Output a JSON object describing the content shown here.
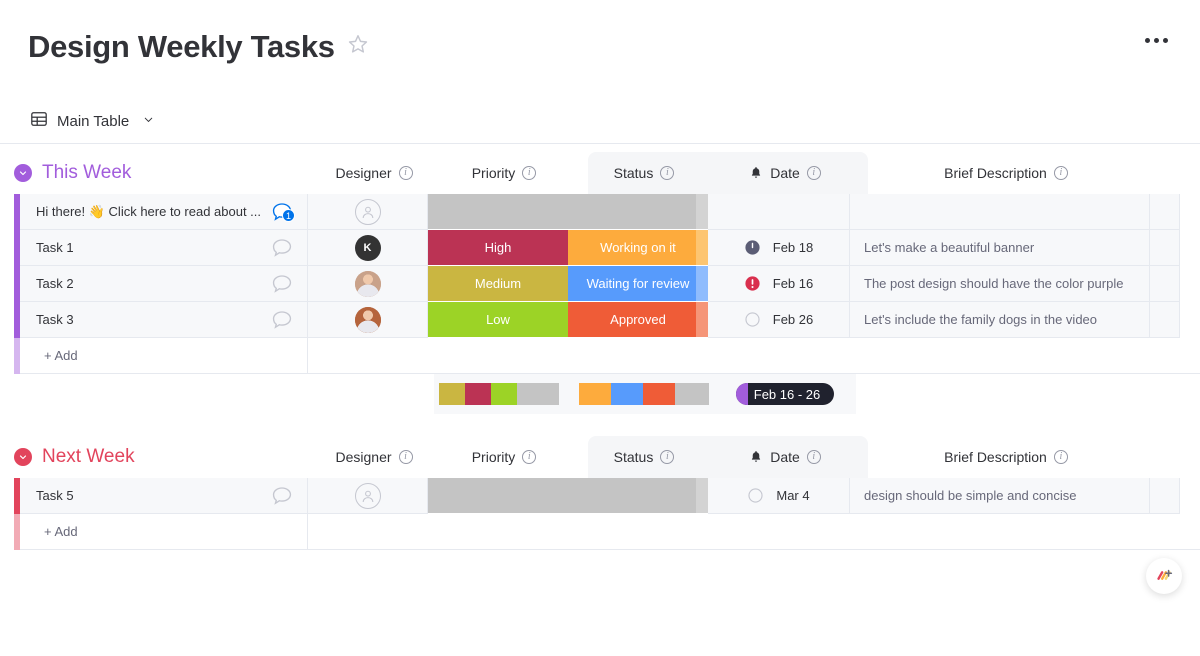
{
  "header": {
    "title": "Design Weekly Tasks",
    "favorite_icon": "star-icon",
    "menu_icon": "kebab-menu-icon"
  },
  "tab": {
    "icon": "table-icon",
    "label": "Main Table",
    "chevron_icon": "chevron-down-icon"
  },
  "columns": {
    "name": "",
    "person": "Designer",
    "priority": "Priority",
    "status": "Status",
    "date": "Date",
    "date_icon": "bell-icon",
    "description": "Brief Description",
    "info_icon": "info-icon"
  },
  "groups": [
    {
      "title": "This Week",
      "color": "#a25ddc",
      "add_label": "+ Add",
      "rows": [
        {
          "name": "Hi there! 👋 Click here to read about ...",
          "chat_badge": "1",
          "chat_style": "blue",
          "person": {
            "type": "empty",
            "label": ""
          },
          "priority": {
            "label": "",
            "color": "#c4c4c4"
          },
          "status": {
            "label": "",
            "color": "#c4c4c4",
            "tail": "#d3d3d3"
          },
          "date": {
            "label": "",
            "icon": "none"
          },
          "description": ""
        },
        {
          "name": "Task 1",
          "chat_badge": "",
          "chat_style": "grey",
          "person": {
            "type": "initial",
            "label": "K",
            "color": "#333333"
          },
          "priority": {
            "label": "High",
            "color": "#bb3354"
          },
          "status": {
            "label": "Working on it",
            "color": "#fdab3d",
            "tail": "#fdc571"
          },
          "date": {
            "label": "Feb 18",
            "icon": "clock"
          },
          "description": "Let's make a beautiful banner"
        },
        {
          "name": "Task 2",
          "chat_badge": "",
          "chat_style": "grey",
          "person": {
            "type": "photo",
            "label": "",
            "color": "#c9a28a"
          },
          "priority": {
            "label": "Medium",
            "color": "#cab641"
          },
          "status": {
            "label": "Waiting for review",
            "color": "#579bfc",
            "tail": "#8fbcfd"
          },
          "date": {
            "label": "Feb 16",
            "icon": "alert"
          },
          "description": "The post design should have the color purple"
        },
        {
          "name": "Task 3",
          "chat_badge": "",
          "chat_style": "grey",
          "person": {
            "type": "photo",
            "label": "",
            "color": "#b5643c"
          },
          "priority": {
            "label": "Low",
            "color": "#9cd326"
          },
          "status": {
            "label": "Approved",
            "color": "#ef5c37",
            "tail": "#f59578"
          },
          "date": {
            "label": "Feb 26",
            "icon": "empty"
          },
          "description": "Let's include the family dogs in the video"
        }
      ],
      "summary": {
        "priority_segments": [
          {
            "color": "#cab641",
            "width": 26
          },
          {
            "color": "#bb3354",
            "width": 26
          },
          {
            "color": "#9cd326",
            "width": 26
          },
          {
            "color": "#c4c4c4",
            "width": 42
          }
        ],
        "status_segments": [
          {
            "color": "#fdab3d",
            "width": 32
          },
          {
            "color": "#579bfc",
            "width": 32
          },
          {
            "color": "#ef5c37",
            "width": 32
          },
          {
            "color": "#c4c4c4",
            "width": 34
          }
        ],
        "date_range": "Feb 16 - 26",
        "date_cap_color": "#a25ddc"
      }
    },
    {
      "title": "Next Week",
      "color": "#e2445c",
      "add_label": "+ Add",
      "rows": [
        {
          "name": "Task 5",
          "chat_badge": "",
          "chat_style": "grey",
          "person": {
            "type": "empty",
            "label": ""
          },
          "priority": {
            "label": "",
            "color": "#c4c4c4"
          },
          "status": {
            "label": "",
            "color": "#c4c4c4",
            "tail": "#d3d3d3"
          },
          "date": {
            "label": "Mar 4",
            "icon": "empty"
          },
          "description": "design should be simple and concise"
        }
      ]
    }
  ],
  "float_button": {
    "icon": "add-widget-icon"
  }
}
